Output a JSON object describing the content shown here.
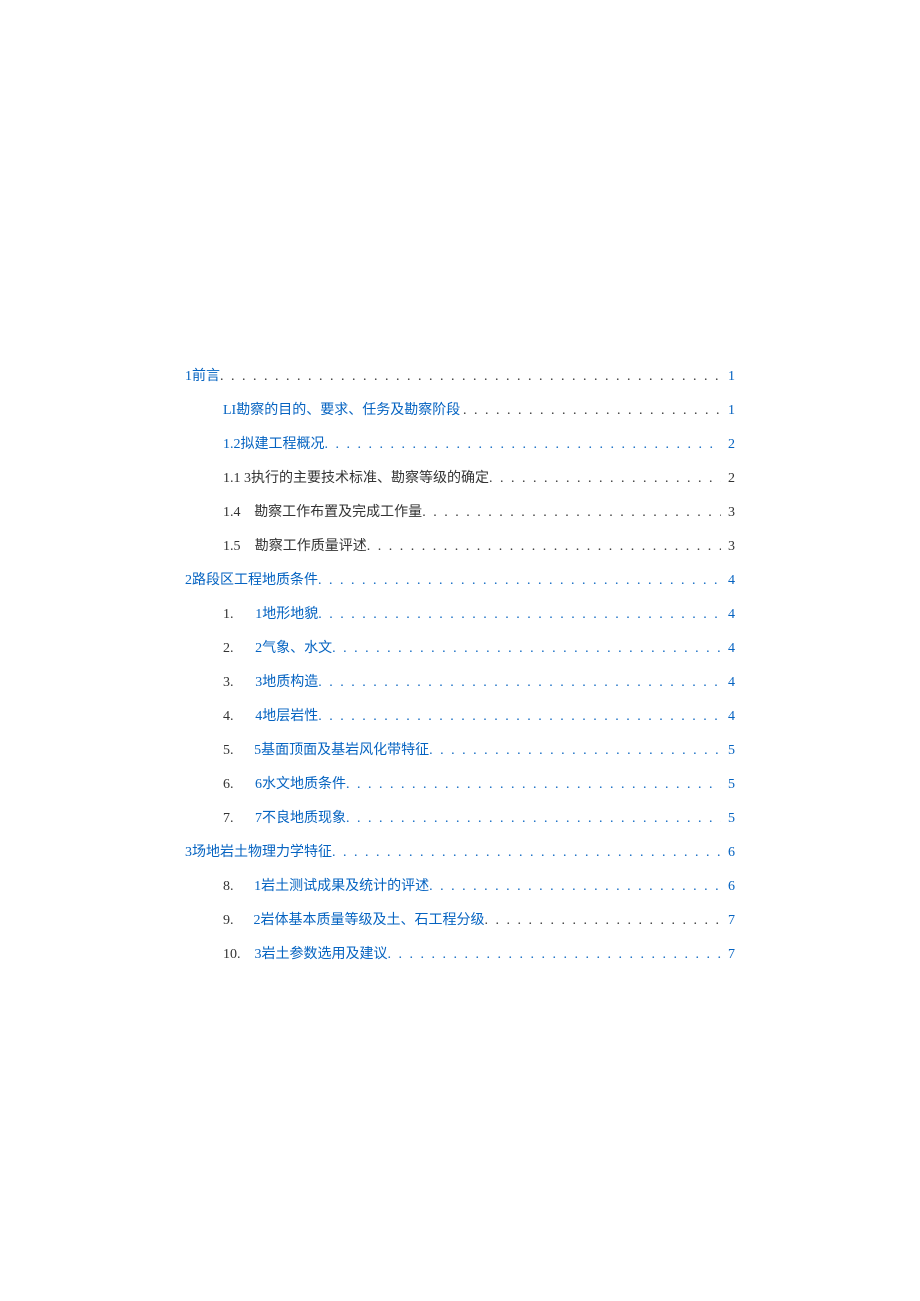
{
  "toc": [
    {
      "indent": 0,
      "marker": "",
      "title": "1前言",
      "page": "1",
      "linked": true,
      "dotsBlue": false
    },
    {
      "indent": 1,
      "marker": "",
      "title": "LI勘察的目的、要求、任务及勘察阶段",
      "page": "1",
      "linked": true,
      "dotsBlue": false,
      "preGap": true
    },
    {
      "indent": 1,
      "marker": "",
      "title": "1.2拟建工程概况",
      "page": "2",
      "linked": true,
      "dotsBlue": true
    },
    {
      "indent": 1,
      "marker": "",
      "title": "1.1 3执行的主要技术标准、勘察等级的确定",
      "page": "2",
      "linked": false,
      "dotsBlue": false
    },
    {
      "indent": 1,
      "marker": "1.4",
      "title": "勘察工作布置及完成工作量",
      "page": "3",
      "linked": false,
      "dotsBlue": false
    },
    {
      "indent": 1,
      "marker": "1.5",
      "title": "勘察工作质量评述",
      "page": "3",
      "linked": false,
      "dotsBlue": false
    },
    {
      "indent": 0,
      "marker": "",
      "title": "2路段区工程地质条件",
      "page": "4",
      "linked": true,
      "dotsBlue": true
    },
    {
      "indent": 1,
      "marker": "1.",
      "title": "1地形地貌",
      "page": "4",
      "linked": true,
      "dotsBlue": true
    },
    {
      "indent": 1,
      "marker": "2.",
      "title": "2气象、水文",
      "page": "4",
      "linked": true,
      "dotsBlue": true
    },
    {
      "indent": 1,
      "marker": "3.",
      "title": "3地质构造",
      "page": "4",
      "linked": true,
      "dotsBlue": true
    },
    {
      "indent": 1,
      "marker": "4.",
      "title": "4地层岩性",
      "page": "4",
      "linked": true,
      "dotsBlue": true
    },
    {
      "indent": 1,
      "marker": "5.",
      "title": "5基面顶面及基岩风化带特征",
      "page": "5",
      "linked": true,
      "dotsBlue": true
    },
    {
      "indent": 1,
      "marker": "6.",
      "title": "6水文地质条件",
      "page": "5",
      "linked": true,
      "dotsBlue": true
    },
    {
      "indent": 1,
      "marker": "7.",
      "title": "7不良地质现象",
      "page": "5",
      "linked": true,
      "dotsBlue": true
    },
    {
      "indent": 0,
      "marker": "",
      "title": "3场地岩土物理力学特征",
      "page": "6",
      "linked": true,
      "dotsBlue": true
    },
    {
      "indent": 1,
      "marker": "8.",
      "title": "1岩土测试成果及统计的评述",
      "page": "6",
      "linked": true,
      "dotsBlue": true
    },
    {
      "indent": 1,
      "marker": "9.",
      "title": "2岩体基本质量等级及土、石工程分级",
      "page": "7",
      "linked": true,
      "dotsBlue": false
    },
    {
      "indent": 1,
      "marker": "10.",
      "title": "3岩土参数选用及建议",
      "page": "7",
      "linked": true,
      "dotsBlue": true
    }
  ],
  "dotfill": ". . . . . . . . . . . . . . . . . . . . . . . . . . . . . . . . . . . . . . . . . . . . . . . . . . . . . . . . . . . . . . . . . . . . . . . . . . . . . . . . . . . . . . . . . . . . . . . . . . . . . . . . . . . . . . . . . . . . . . . ."
}
